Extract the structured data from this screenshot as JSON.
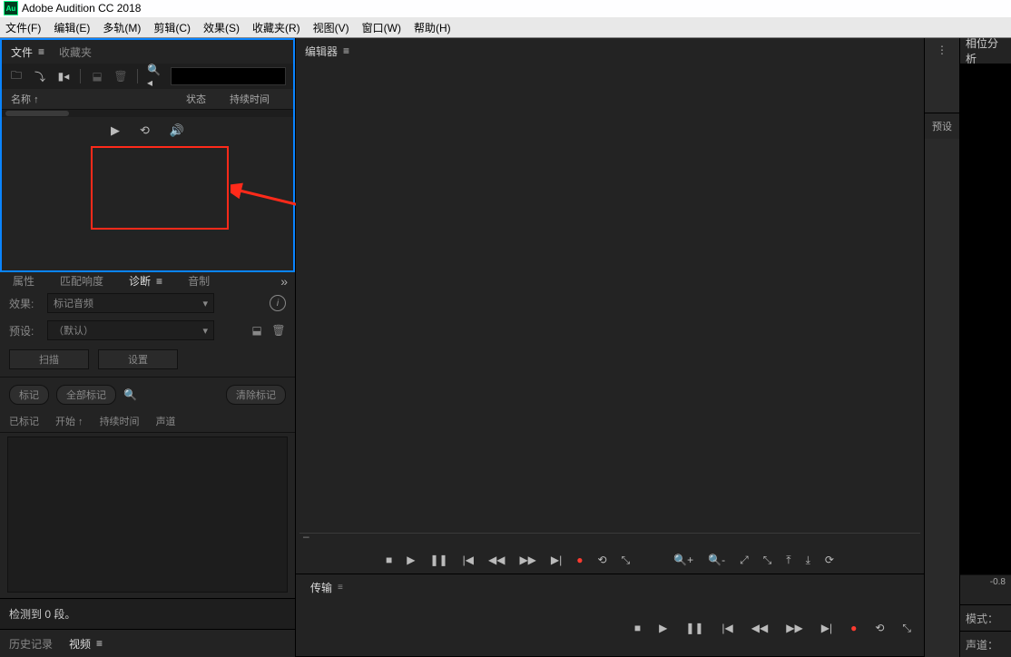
{
  "title_bar": {
    "app_name": "Adobe Audition CC 2018",
    "logo_text": "Au"
  },
  "menu": {
    "file": "文件(F)",
    "edit": "编辑(E)",
    "multitrack": "多轨(M)",
    "clip": "剪辑(C)",
    "effects": "效果(S)",
    "favorites": "收藏夹(R)",
    "view": "视图(V)",
    "window": "窗口(W)",
    "help": "帮助(H)"
  },
  "files_panel": {
    "tab_files": "文件",
    "tab_favorites": "收藏夹",
    "search_placeholder": "",
    "col_name": "名称",
    "col_status": "状态",
    "col_duration": "持续时间",
    "icons": {
      "open": "folder",
      "import": "import",
      "new": "new",
      "save": "save",
      "trash": "trash",
      "search": "search"
    }
  },
  "diagnostics": {
    "tabs": {
      "props": "属性",
      "loudness": "匹配响度",
      "diag": "诊断",
      "sound": "音制"
    },
    "effect_label": "效果:",
    "effect_value": "标记音频",
    "preset_label": "预设:",
    "preset_value": "（默认）",
    "btn_scan": "扫描",
    "btn_settings": "设置",
    "pill_mark": "标记",
    "pill_mark_all": "全部标记",
    "pill_clear": "清除标记",
    "col_marked": "已标记",
    "col_start": "开始",
    "col_duration": "持续时间",
    "col_channel": "声道",
    "status": "检测到 0 段。"
  },
  "bottom_tabs": {
    "history": "历史记录",
    "video": "视频"
  },
  "editor": {
    "title": "编辑器",
    "dash": "–"
  },
  "transport": {
    "title": "传输"
  },
  "right_strip": {
    "preset": "预设"
  },
  "right_panel": {
    "title": "相位分析",
    "scale": "-0.8",
    "mode": "模式：",
    "channel": "声道："
  }
}
